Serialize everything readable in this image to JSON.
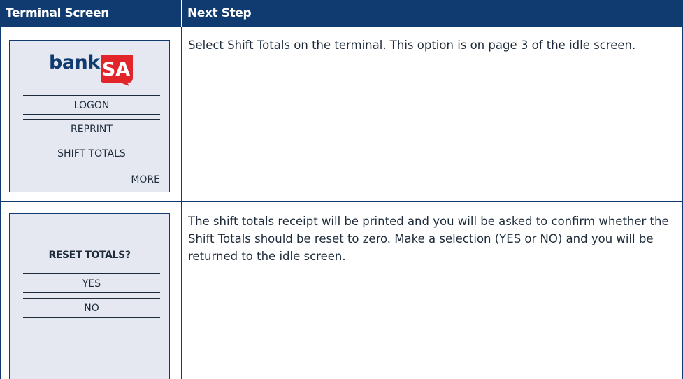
{
  "table": {
    "headers": {
      "terminal_screen": "Terminal Screen",
      "next_step": "Next Step"
    },
    "rows": [
      {
        "screen": {
          "logo": {
            "bank": "bank",
            "sa": "SA"
          },
          "menu": [
            "LOGON",
            "REPRINT",
            "SHIFT TOTALS"
          ],
          "more": "MORE"
        },
        "step": "Select Shift Totals on the terminal. This option is on page 3 of the idle screen."
      },
      {
        "screen": {
          "prompt": "RESET TOTALS?",
          "menu": [
            "YES",
            "NO"
          ]
        },
        "step": "The shift totals receipt will be printed and you will be asked to confirm whether the Shift Totals should be reset to zero. Make a selection (YES or NO) and you will be returned to the idle screen."
      }
    ]
  },
  "colors": {
    "header_bg": "#0f3b70",
    "screen_bg": "#e6e8f1",
    "logo_red": "#e2242b",
    "text": "#1d2b3a"
  }
}
